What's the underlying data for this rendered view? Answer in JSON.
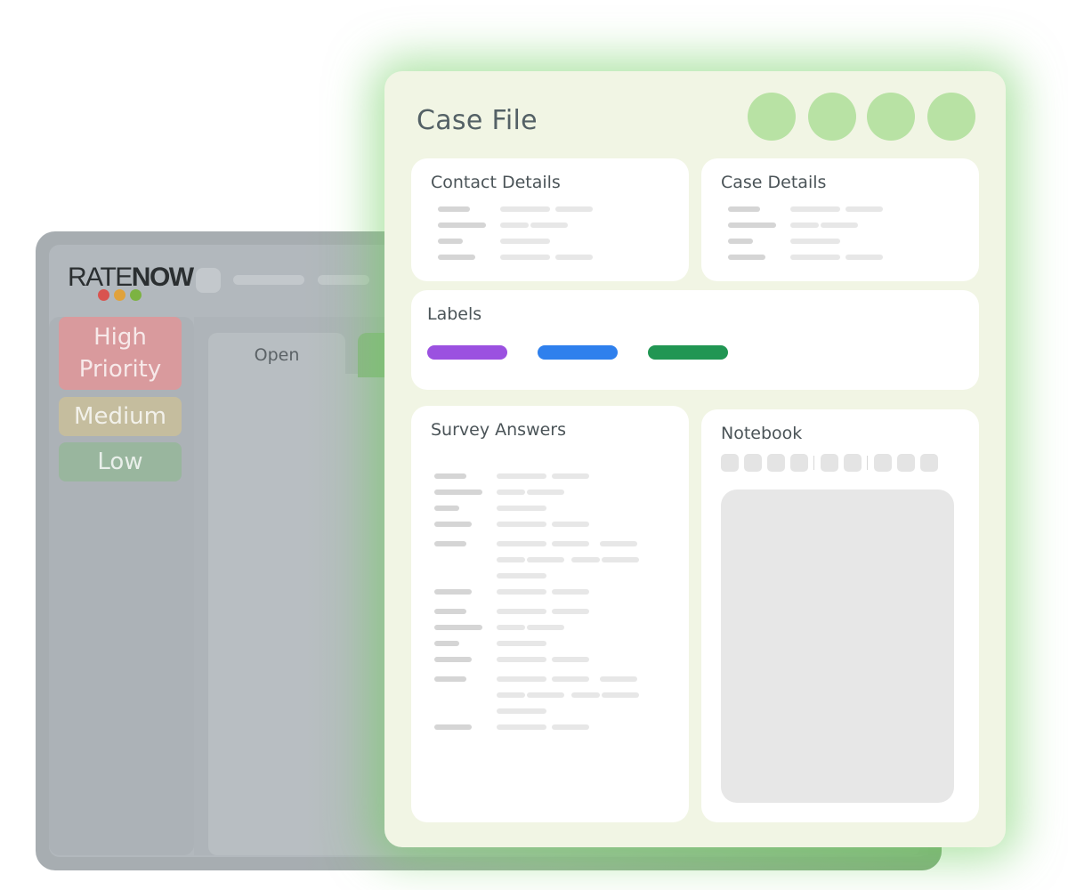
{
  "background_app": {
    "logo": {
      "part1": "RATE",
      "part2": "NOW",
      "dot_colors": [
        "#d9534f",
        "#e0a23b",
        "#7cb342"
      ]
    },
    "priorities": [
      {
        "label": "High Priority",
        "color": "#d99a9d"
      },
      {
        "label": "Medium",
        "color": "#c5bd9e"
      },
      {
        "label": "Low",
        "color": "#99b69e"
      }
    ],
    "tabs": [
      {
        "label": "Open"
      }
    ]
  },
  "case_file": {
    "title": "Case File",
    "accent_color": "#b8e2a4",
    "cards": {
      "contact_details": {
        "title": "Contact Details"
      },
      "case_details": {
        "title": "Case Details"
      },
      "labels": {
        "title": "Labels",
        "pill_colors": [
          "#9b51e0",
          "#2f80ed",
          "#219653"
        ]
      },
      "survey_answers": {
        "title": "Survey Answers"
      },
      "notebook": {
        "title": "Notebook"
      }
    }
  }
}
